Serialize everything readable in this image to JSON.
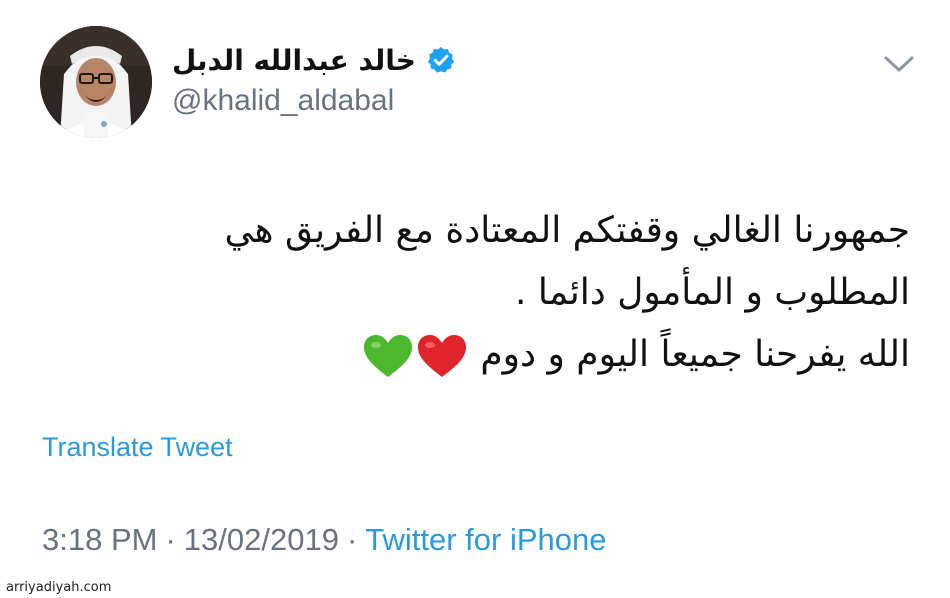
{
  "author": {
    "display_name": "خالد عبدالله الدبل",
    "handle": "@khalid_aldabal",
    "verified": true,
    "avatar_icon": "profile-photo"
  },
  "menu": {
    "icon": "chevron-down-icon"
  },
  "tweet": {
    "lines": [
      "جمهورنا الغالي وقفتكم المعتادة مع الفريق هي",
      "المطلوب و المأمول دائما .",
      "الله يفرحنا جميعاً اليوم و دوم"
    ],
    "emojis": [
      "red-heart-icon",
      "green-heart-icon"
    ]
  },
  "translate_label": "Translate Tweet",
  "meta": {
    "time": "3:18 PM",
    "separator": "·",
    "date": "13/02/2019",
    "source": "Twitter for iPhone"
  },
  "watermark": "arriyadiyah.com",
  "colors": {
    "link_blue": "#2a9ae0",
    "verified_blue": "#1da1f2",
    "secondary_text": "#667380",
    "primary_text": "#111111",
    "heart_red": "#e0242b",
    "heart_green": "#4cb82e"
  }
}
